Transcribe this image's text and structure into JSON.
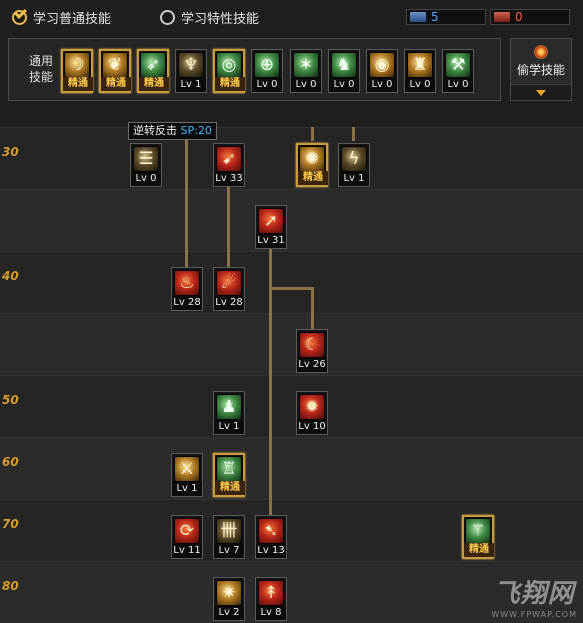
{
  "tabs": {
    "normal": {
      "label": "学习普通技能",
      "selected": true
    },
    "special": {
      "label": "学习特性技能",
      "selected": false
    }
  },
  "points": {
    "sp": "5",
    "tp": "0"
  },
  "general": {
    "label": "通用\n技能",
    "skills": [
      {
        "level": "精通",
        "master": true,
        "icon": "sit-figure-icon",
        "glyph": "☽",
        "color": "c-gold"
      },
      {
        "level": "精通",
        "master": true,
        "icon": "crouch-figure-icon",
        "glyph": "❦",
        "color": "c-gold"
      },
      {
        "level": "精通",
        "master": true,
        "icon": "dash-figure-icon",
        "glyph": "➶",
        "color": "c-green"
      },
      {
        "level": "Lv 1",
        "master": false,
        "icon": "wings-icon",
        "glyph": "♆",
        "color": "c-dark"
      },
      {
        "level": "精通",
        "master": true,
        "icon": "target-icon",
        "glyph": "◎",
        "color": "c-green"
      },
      {
        "level": "Lv 0",
        "master": false,
        "icon": "crosshair-icon",
        "glyph": "⊕",
        "color": "c-green"
      },
      {
        "level": "Lv 0",
        "master": false,
        "icon": "burst-figure-icon",
        "glyph": "✶",
        "color": "c-green"
      },
      {
        "level": "Lv 0",
        "master": false,
        "icon": "leap-figure-icon",
        "glyph": "♞",
        "color": "c-green"
      },
      {
        "level": "Lv 0",
        "master": false,
        "icon": "eye-icon",
        "glyph": "◉",
        "color": "c-gold"
      },
      {
        "level": "Lv 0",
        "master": false,
        "icon": "warrior-icon",
        "glyph": "♜",
        "color": "c-gold"
      },
      {
        "level": "Lv 0",
        "master": false,
        "icon": "hammer-icon",
        "glyph": "⚒",
        "color": "c-green"
      }
    ]
  },
  "steal": {
    "label": "偷学技能"
  },
  "tooltip": {
    "name": "逆转反击",
    "sp": "SP:20"
  },
  "levels": [
    "30",
    "40",
    "50",
    "60",
    "70",
    "80"
  ],
  "tree": [
    {
      "id": "s1",
      "level": "Lv 0",
      "master": false,
      "icon": "counter-icon",
      "glyph": "☰",
      "color": "c-dark"
    },
    {
      "id": "s2",
      "level": "Lv 33",
      "master": false,
      "icon": "slash-icon",
      "glyph": "➹",
      "color": "c-red"
    },
    {
      "id": "s3",
      "level": "精通",
      "master": true,
      "icon": "starburst-icon",
      "glyph": "✺",
      "color": "c-gold"
    },
    {
      "id": "s4",
      "level": "Lv 1",
      "master": false,
      "icon": "lightning-icon",
      "glyph": "ϟ",
      "color": "c-dark"
    },
    {
      "id": "s5",
      "level": "Lv 31",
      "master": false,
      "icon": "crescent-slash-icon",
      "glyph": "➚",
      "color": "c-red"
    },
    {
      "id": "s6",
      "level": "Lv 28",
      "master": false,
      "icon": "dragon-icon",
      "glyph": "♨",
      "color": "c-red"
    },
    {
      "id": "s7",
      "level": "Lv 28",
      "master": false,
      "icon": "flame-claw-icon",
      "glyph": "☄",
      "color": "c-red"
    },
    {
      "id": "s8",
      "level": "Lv 26",
      "master": false,
      "icon": "arc-slash-icon",
      "glyph": "☾",
      "color": "c-red"
    },
    {
      "id": "s9",
      "level": "Lv 1",
      "master": false,
      "icon": "green-warrior-icon",
      "glyph": "♟",
      "color": "c-green"
    },
    {
      "id": "s10",
      "level": "Lv 10",
      "master": false,
      "icon": "blast-icon",
      "glyph": "✹",
      "color": "c-red"
    },
    {
      "id": "s11",
      "level": "Lv 1",
      "master": false,
      "icon": "blade-rush-icon",
      "glyph": "⚔",
      "color": "c-gold"
    },
    {
      "id": "s12",
      "level": "精通",
      "master": true,
      "icon": "pillar-icon",
      "glyph": "♖",
      "color": "c-green"
    },
    {
      "id": "s13",
      "level": "Lv 11",
      "master": false,
      "icon": "fire-swirl-icon",
      "glyph": "⟳",
      "color": "c-red"
    },
    {
      "id": "s14",
      "level": "Lv 7",
      "master": false,
      "icon": "rune-icon",
      "glyph": "卌",
      "color": "c-dark"
    },
    {
      "id": "s15",
      "level": "Lv 13",
      "master": false,
      "icon": "crimson-slash-icon",
      "glyph": "➷",
      "color": "c-red"
    },
    {
      "id": "s16",
      "level": "精通",
      "master": true,
      "icon": "green-blade-icon",
      "glyph": "⚚",
      "color": "c-green"
    },
    {
      "id": "s17",
      "level": "Lv 2",
      "master": false,
      "icon": "explosion-icon",
      "glyph": "✷",
      "color": "c-gold"
    },
    {
      "id": "s18",
      "level": "Lv 8",
      "master": false,
      "icon": "fire-spear-icon",
      "glyph": "↟",
      "color": "c-red"
    }
  ],
  "watermark": {
    "big": "飞翔网",
    "small": "WWW.FPWAP.COM"
  }
}
